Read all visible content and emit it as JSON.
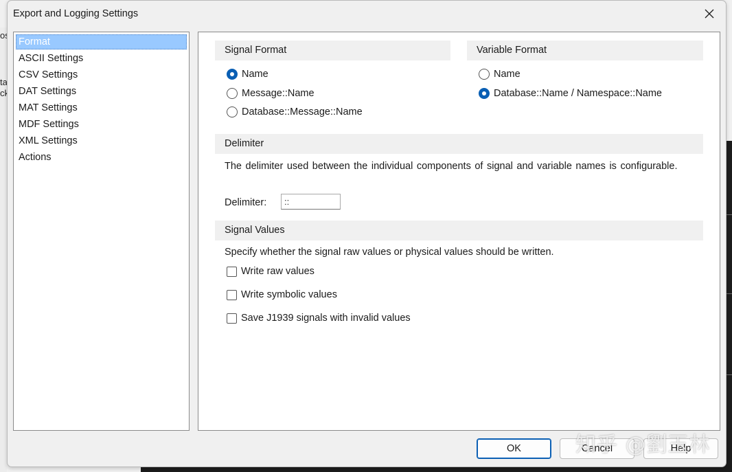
{
  "dialog": {
    "title": "Export and Logging Settings"
  },
  "nav": {
    "items": [
      {
        "label": "Format",
        "selected": true
      },
      {
        "label": "ASCII Settings",
        "selected": false
      },
      {
        "label": "CSV Settings",
        "selected": false
      },
      {
        "label": "DAT Settings",
        "selected": false
      },
      {
        "label": "MAT Settings",
        "selected": false
      },
      {
        "label": "MDF Settings",
        "selected": false
      },
      {
        "label": "XML Settings",
        "selected": false
      },
      {
        "label": "Actions",
        "selected": false
      }
    ]
  },
  "signal_format": {
    "header": "Signal Format",
    "options": [
      {
        "label": "Name",
        "checked": true
      },
      {
        "label": "Message::Name",
        "checked": false
      },
      {
        "label": "Database::Message::Name",
        "checked": false
      }
    ]
  },
  "variable_format": {
    "header": "Variable Format",
    "options": [
      {
        "label": "Name",
        "checked": false
      },
      {
        "label": "Database::Name / Namespace::Name",
        "checked": true
      }
    ]
  },
  "delimiter": {
    "header": "Delimiter",
    "description": "The delimiter used between the individual components of signal and variable names is configurable.",
    "label": "Delimiter:",
    "value": "::"
  },
  "signal_values": {
    "header": "Signal Values",
    "description": "Specify whether the signal raw values or physical values should be written.",
    "options": [
      {
        "label": "Write raw values",
        "checked": false
      },
      {
        "label": "Write symbolic values",
        "checked": false
      },
      {
        "label": "Save J1939 signals with invalid values",
        "checked": false
      }
    ]
  },
  "buttons": {
    "ok": "OK",
    "cancel": "Cancel",
    "help": "Help"
  },
  "background": {
    "left_fragments": [
      "os",
      "ta",
      "ck"
    ]
  },
  "watermark": "知乎 @劉玉林",
  "colors": {
    "accent": "#0a5fb4",
    "selection": "#99c9ff"
  }
}
